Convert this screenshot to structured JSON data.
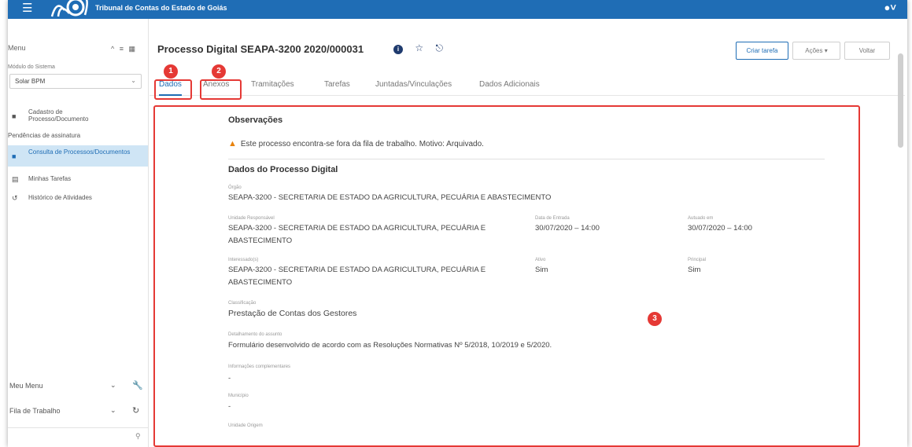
{
  "topbar": {
    "menu_icon": "hamburger-icon",
    "org_name": "Tribunal de Contas do Estado de Goiás",
    "user_icon": "user-icon"
  },
  "sidebar": {
    "menu_title": "Menu",
    "module_label": "Módulo do Sistema",
    "module_value": "Solar BPM",
    "items": [
      {
        "label": "Cadastro de Processo/Documento",
        "icon": "folder-icon",
        "active": false
      },
      {
        "label": "Pendências de assinatura",
        "icon": "",
        "active": false
      },
      {
        "label": "Consulta de Processos/Documentos",
        "icon": "folder-icon",
        "active": true
      },
      {
        "label": "Minhas Tarefas",
        "icon": "calendar-icon",
        "active": false
      },
      {
        "label": "Histórico de Atividades",
        "icon": "history-icon",
        "active": false
      }
    ],
    "bottom": [
      {
        "label": "Meu Menu"
      },
      {
        "label": "Fila de Trabalho"
      }
    ]
  },
  "main": {
    "title": "Processo Digital SEAPA-3200 2020/000031",
    "buttons": {
      "create_task": "Criar tarefa",
      "actions": "Ações ▾",
      "back": "Voltar"
    },
    "tabs": [
      "Dados",
      "Anexos",
      "Tramitações",
      "Tarefas",
      "Juntadas/Vinculações",
      "Dados Adicionais"
    ],
    "observations": {
      "title": "Observações",
      "warning": "Este processo encontra-se fora da fila de trabalho. Motivo: Arquivado."
    },
    "details": {
      "title": "Dados do Processo Digital",
      "orgao_label": "Órgão",
      "orgao_value": "SEAPA-3200 - SECRETARIA DE ESTADO DA AGRICULTURA, PECUÁRIA E ABASTECIMENTO",
      "unidade_label": "Unidade Responsável",
      "unidade_value_1": "SEAPA-3200 - SECRETARIA DE ESTADO DA AGRICULTURA, PECUÁRIA E",
      "unidade_value_2": "ABASTECIMENTO",
      "entrada_label": "Data de Entrada",
      "entrada_value": "30/07/2020 – 14:00",
      "autuado_label": "Autuado em",
      "autuado_value": "30/07/2020 – 14:00",
      "interessado_label": "Interessado(s)",
      "interessado_value_1": "SEAPA-3200 - SECRETARIA DE ESTADO DA AGRICULTURA, PECUÁRIA E",
      "interessado_value_2": "ABASTECIMENTO",
      "ativo_label": "Ativo",
      "ativo_value": "Sim",
      "principal_label": "Principal",
      "principal_value": "Sim",
      "classificacao_label": "Classificação",
      "classificacao_value": "Prestação de Contas dos Gestores",
      "detalhamento_label": "Detalhamento do assunto",
      "detalhamento_value": "Formulário desenvolvido de acordo com as Resoluções Normativas Nº 5/2018, 10/2019 e 5/2020.",
      "info_label": "Informações complementares",
      "info_value": "-",
      "municipio_label": "Município",
      "municipio_value": "-",
      "unidade_origem_label": "Unidade Origem"
    }
  },
  "annotations": [
    "1",
    "2",
    "3"
  ],
  "colors": {
    "brand": "#1f6db5",
    "annotation": "#e53935",
    "warning": "#e8830e"
  }
}
